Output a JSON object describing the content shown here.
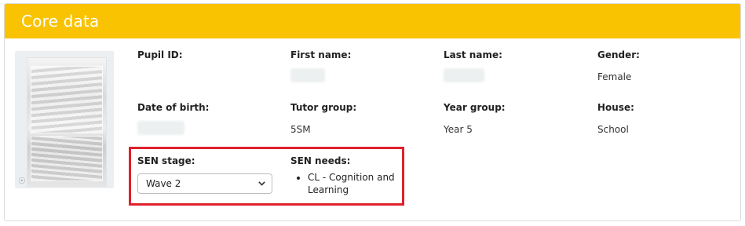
{
  "panel": {
    "title": "Core data"
  },
  "fields": {
    "pupil_id": {
      "label": "Pupil ID:",
      "value": ""
    },
    "first_name": {
      "label": "First name:",
      "value": ""
    },
    "last_name": {
      "label": "Last name:",
      "value": ""
    },
    "gender": {
      "label": "Gender:",
      "value": "Female"
    },
    "date_of_birth": {
      "label": "Date of birth:",
      "value": ""
    },
    "tutor_group": {
      "label": "Tutor group:",
      "value": "5SM"
    },
    "year_group": {
      "label": "Year group:",
      "value": "Year 5"
    },
    "house": {
      "label": "House:",
      "value": "School"
    }
  },
  "sen": {
    "stage_label": "SEN stage:",
    "stage_selected": "Wave 2",
    "needs_label": "SEN needs:",
    "needs": [
      "CL - Cognition and Learning"
    ]
  },
  "colors": {
    "header": "#f9c301",
    "highlight": "#e0202c"
  },
  "icons": {
    "photo_corner": "camera-icon",
    "select": "chevron-down-icon"
  }
}
